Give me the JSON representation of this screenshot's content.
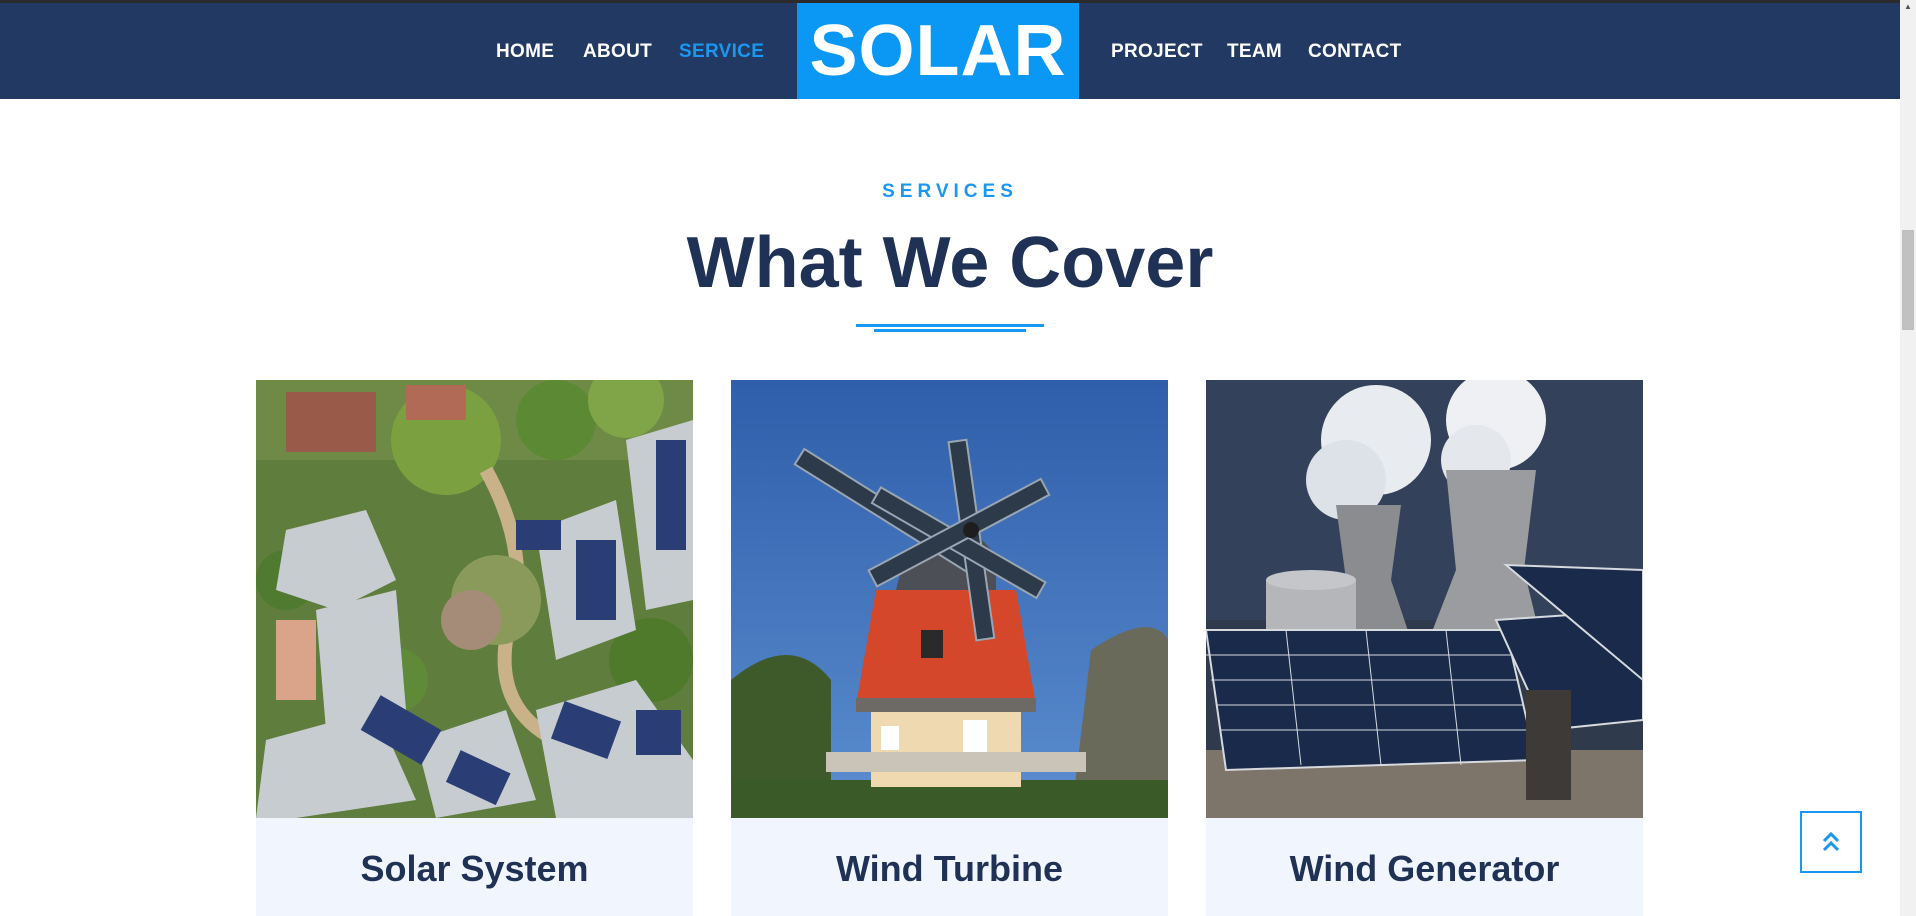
{
  "nav": {
    "left": [
      "HOME",
      "ABOUT",
      "SERVICE"
    ],
    "right": [
      "PROJECT",
      "TEAM",
      "CONTACT"
    ],
    "logo": "SOLAR",
    "active": "SERVICE"
  },
  "section": {
    "eyebrow": "SERVICES",
    "title": "What We Cover"
  },
  "services": [
    {
      "title": "Solar System",
      "image": "aerial view of housing complex with rooftop solar panels"
    },
    {
      "title": "Wind Turbine",
      "image": "windmill with solar panel sails and red roof"
    },
    {
      "title": "Wind Generator",
      "image": "cooling towers with solar panel arrays"
    }
  ],
  "back_to_top": {
    "icon": "double-chevron-up-icon"
  },
  "colors": {
    "navy": "#223a63",
    "accent": "#1a97f0",
    "logo_bg": "#0b97f4",
    "card_caption_bg": "#f1f5fd"
  }
}
